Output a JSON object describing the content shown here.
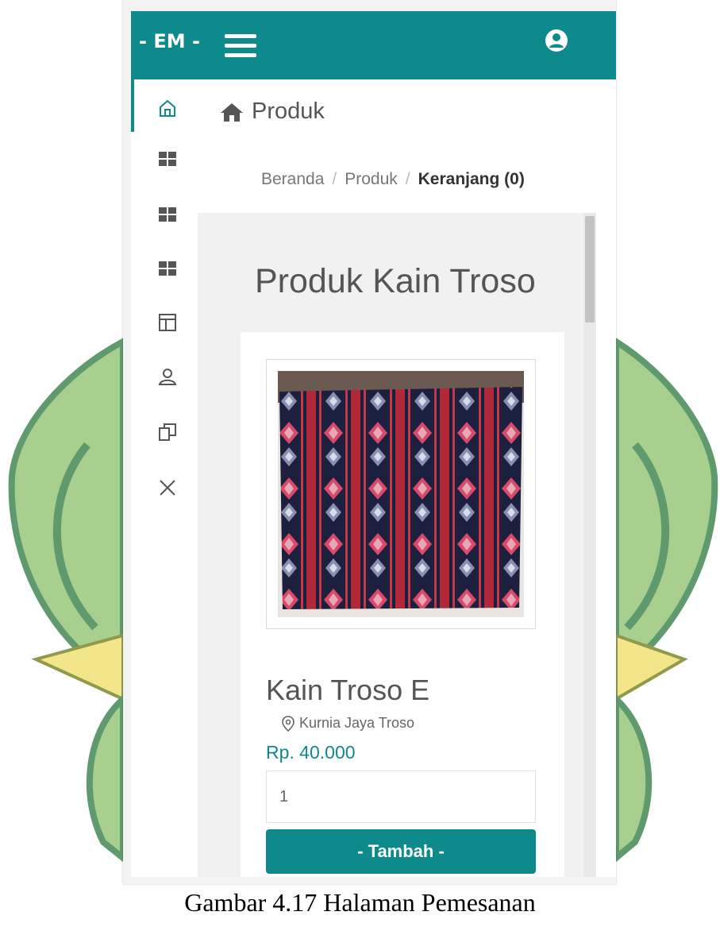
{
  "topbar": {
    "brand": "- EM -",
    "menu_icon": "hamburger-icon",
    "user_icon": "user-circle-icon"
  },
  "sidebar": {
    "items": [
      {
        "icon": "home-icon",
        "active": true
      },
      {
        "icon": "grid-icon"
      },
      {
        "icon": "grid-icon"
      },
      {
        "icon": "grid-icon"
      },
      {
        "icon": "layout-icon"
      },
      {
        "icon": "user-icon"
      },
      {
        "icon": "copy-icon"
      },
      {
        "icon": "close-icon"
      }
    ]
  },
  "page": {
    "title": "Produk",
    "title_icon": "home-icon"
  },
  "breadcrumb": {
    "home": "Beranda",
    "products": "Produk",
    "cart": "Keranjang (0)"
  },
  "section_title": "Produk Kain Troso",
  "product": {
    "image": "woven-fabric-image",
    "name": "Kain Troso E",
    "store": "Kurnia Jaya Troso",
    "store_icon": "location-pin-icon",
    "price": "Rp. 40.000",
    "quantity": "1",
    "add_label": "- Tambah -"
  },
  "caption": "Gambar 4.17 Halaman Pemesanan",
  "colors": {
    "primary": "#0e8a8c",
    "emblem_green": "#a8cf8e",
    "emblem_dark": "#5f9a6e",
    "emblem_yellow": "#f2e58a"
  }
}
